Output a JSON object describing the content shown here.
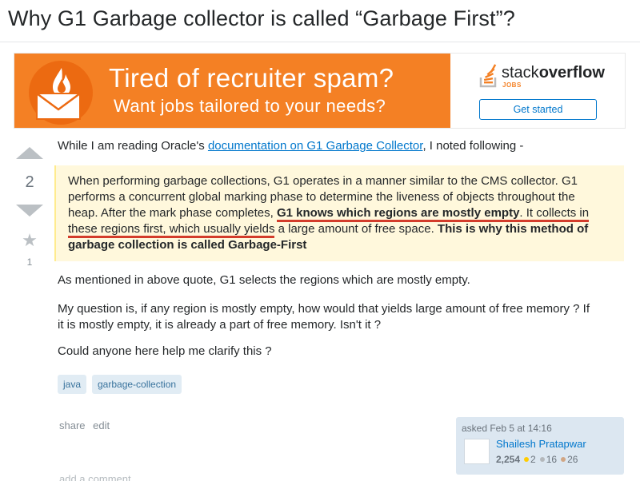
{
  "question": {
    "title": "Why G1 Garbage collector is called “Garbage First”?",
    "votes": "2",
    "favorites": "1",
    "body": {
      "intro_before": "While I am reading Oracle's ",
      "intro_link": "documentation on G1 Garbage Collector",
      "intro_after": ", I noted following -",
      "quote": {
        "line1": "When performing garbage collections, G1 operates in a manner similar to the CMS collector. G1",
        "line2": "performs a concurrent global marking phase to determine the liveness of objects throughout the",
        "line3_before": "heap. After the mark phase completes, ",
        "line3_bold": "G1 knows which regions are mostly empty",
        "line3_after": ". It collects in",
        "line4_underlined": "these regions first, which usually yields",
        "line4_after": " a large amount of free space. ",
        "line4_bold": "This is why this method of",
        "line5_bold": "garbage collection is called Garbage-First"
      },
      "p2": "As mentioned in above quote, G1 selects the regions which are mostly empty.",
      "p3_line1": "My question is, if any region is mostly empty, how would that yields large amount of free memory ? If",
      "p3_line2": "it is mostly empty, it is already a part of free memory. Isn't it ?",
      "p4": "Could anyone here help me clarify this ?"
    },
    "tags": [
      "java",
      "garbage-collection"
    ],
    "menu": {
      "share": "share",
      "edit": "edit"
    },
    "asked": "asked Feb 5 at 14:16",
    "user": {
      "name": "Shailesh Pratapwar",
      "reputation": "2,254",
      "gold": "2",
      "silver": "16",
      "bronze": "26"
    },
    "add_comment": "add a comment"
  },
  "ad": {
    "line1": "Tired of recruiter spam?",
    "line2": "Want jobs tailored to your needs?",
    "logo_light": "stack",
    "logo_bold": "overflow",
    "logo_sub": "JOBS",
    "cta": "Get started"
  },
  "colors": {
    "ad_orange": "#f48024",
    "link": "#0077cc",
    "quote_bg": "#fff8dc",
    "highlight_underline": "#d33c2b",
    "tag_bg": "#e1ecf4",
    "user_card_bg": "#dce7f1"
  }
}
